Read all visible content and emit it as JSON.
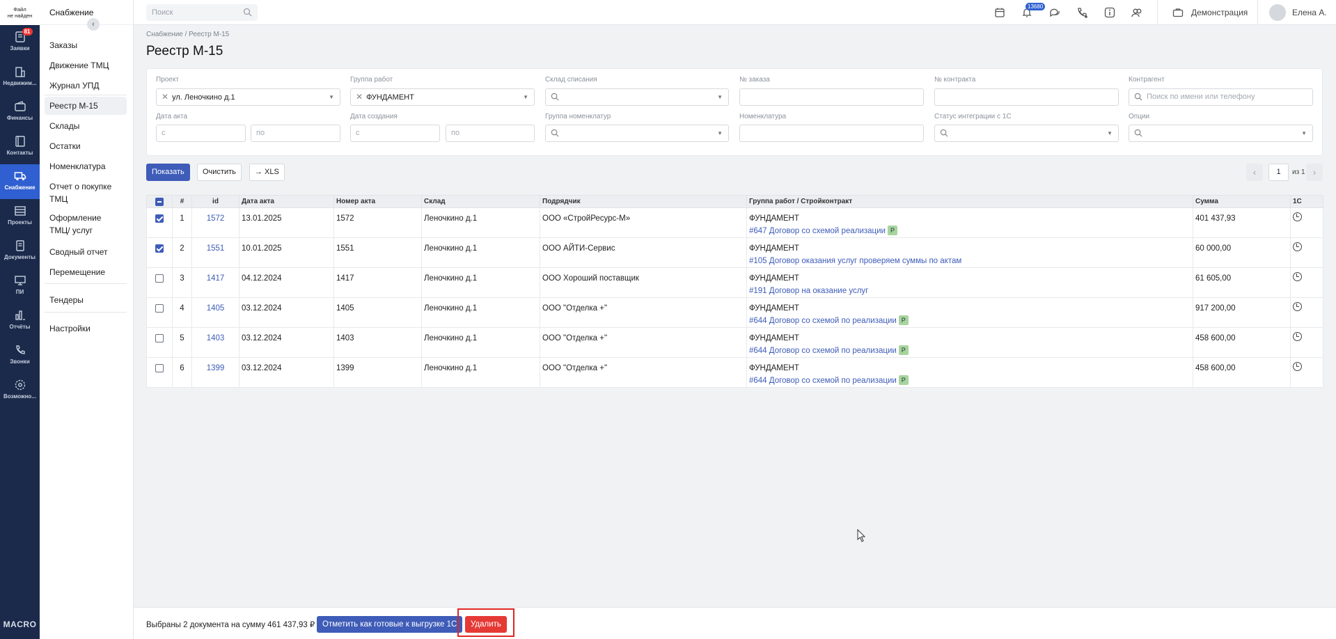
{
  "rail": {
    "file_notice": "Файл\nне найден",
    "items": [
      {
        "label": "Заявки",
        "icon": "requests-icon",
        "badge": "81"
      },
      {
        "label": "Недвижим...",
        "icon": "building-icon"
      },
      {
        "label": "Финансы",
        "icon": "wallet-icon"
      },
      {
        "label": "Контакты",
        "icon": "contacts-icon"
      },
      {
        "label": "Снабжение",
        "icon": "truck-icon",
        "active": true
      },
      {
        "label": "Проекты",
        "icon": "projects-icon"
      },
      {
        "label": "Документы",
        "icon": "documents-icon"
      },
      {
        "label": "ПИ",
        "icon": "monitor-icon"
      },
      {
        "label": "Отчёты",
        "icon": "reports-icon"
      },
      {
        "label": "Звонки",
        "icon": "phone-icon"
      },
      {
        "label": "Возможно...",
        "icon": "settings-gear-icon"
      }
    ],
    "logo": "MACRO"
  },
  "sidebar": {
    "title": "Снабжение",
    "items": [
      {
        "label": "Заказы"
      },
      {
        "label": "Движение ТМЦ"
      },
      {
        "label": "Журнал УПД"
      },
      {
        "label": "Реестр М-15",
        "active": true
      },
      {
        "label": "Склады"
      },
      {
        "label": "Остатки"
      },
      {
        "label": "Номенклатура"
      },
      {
        "label": "Отчет о покупке ТМЦ"
      },
      {
        "label": "Оформление ТМЦ/ услуг"
      },
      {
        "label": "Сводный отчет"
      },
      {
        "label": "Перемещение"
      },
      {
        "label": "Тендеры"
      },
      {
        "label": "Настройки"
      }
    ]
  },
  "topbar": {
    "search_placeholder": "Поиск",
    "notifications_count": "13680",
    "demo_label": "Демонстрация",
    "user_name": "Елена А."
  },
  "breadcrumb": "Снабжение  /  Реестр М-15",
  "page_title": "Реестр М-15",
  "filters": {
    "project": {
      "label": "Проект",
      "value": "ул. Леночкино д.1"
    },
    "work_group": {
      "label": "Группа работ",
      "value": "ФУНДАМЕНТ"
    },
    "writeoff_warehouse": {
      "label": "Склад списания",
      "value": ""
    },
    "order_no": {
      "label": "№ заказа",
      "value": ""
    },
    "contract_no": {
      "label": "№ контракта",
      "value": ""
    },
    "counterparty": {
      "label": "Контрагент",
      "placeholder": "Поиск по имени или телефону"
    },
    "act_date": {
      "label": "Дата акта",
      "from": "с",
      "to": "по"
    },
    "created_date": {
      "label": "Дата создания",
      "from": "с",
      "to": "по"
    },
    "nomenclature_group": {
      "label": "Группа номенклатур",
      "value": ""
    },
    "nomenclature": {
      "label": "Номенклатура",
      "value": ""
    },
    "integration_status": {
      "label": "Статус интеграции с 1С",
      "value": ""
    },
    "options": {
      "label": "Опции",
      "value": ""
    }
  },
  "actions": {
    "show": "Показать",
    "clear": "Очистить",
    "xls": "→ XLS"
  },
  "pager": {
    "page": "1",
    "of": "из 1"
  },
  "table": {
    "headers": [
      "#",
      "id",
      "Дата акта",
      "Номер акта",
      "Склад",
      "Подрядчик",
      "Группа работ / Стройконтракт",
      "Сумма",
      "1С"
    ],
    "rows": [
      {
        "checked": true,
        "n": "1",
        "id": "1572",
        "date": "13.01.2025",
        "act": "1572",
        "warehouse": "Леночкино д.1",
        "contractor": "ООО «СтройРесурс-М»",
        "group": "ФУНДАМЕНТ",
        "contract": "#647 Договор со схемой реализации",
        "tag": "Р",
        "sum": "401 437,93"
      },
      {
        "checked": true,
        "n": "2",
        "id": "1551",
        "date": "10.01.2025",
        "act": "1551",
        "warehouse": "Леночкино д.1",
        "contractor": "ООО АЙТИ-Сервис",
        "group": "ФУНДАМЕНТ",
        "contract": "#105 Договор оказания услуг проверяем суммы по актам",
        "tag": "",
        "sum": "60 000,00"
      },
      {
        "checked": false,
        "n": "3",
        "id": "1417",
        "date": "04.12.2024",
        "act": "1417",
        "warehouse": "Леночкино д.1",
        "contractor": "ООО Хороший поставщик",
        "group": "ФУНДАМЕНТ",
        "contract": "#191 Договор на оказание услуг",
        "tag": "",
        "sum": "61 605,00"
      },
      {
        "checked": false,
        "n": "4",
        "id": "1405",
        "date": "03.12.2024",
        "act": "1405",
        "warehouse": "Леночкино д.1",
        "contractor": "ООО \"Отделка +\"",
        "group": "ФУНДАМЕНТ",
        "contract": "#644 Договор со схемой по реализации",
        "tag": "Р",
        "sum": "917 200,00"
      },
      {
        "checked": false,
        "n": "5",
        "id": "1403",
        "date": "03.12.2024",
        "act": "1403",
        "warehouse": "Леночкино д.1",
        "contractor": "ООО \"Отделка +\"",
        "group": "ФУНДАМЕНТ",
        "contract": "#644 Договор со схемой по реализации",
        "tag": "Р",
        "sum": "458 600,00"
      },
      {
        "checked": false,
        "n": "6",
        "id": "1399",
        "date": "03.12.2024",
        "act": "1399",
        "warehouse": "Леночкино д.1",
        "contractor": "ООО \"Отделка +\"",
        "group": "ФУНДАМЕНТ",
        "contract": "#644 Договор со схемой по реализации",
        "tag": "Р",
        "sum": "458 600,00"
      }
    ]
  },
  "bottom": {
    "selected_text": "Выбраны 2 документа на сумму 461 437,93 ₽",
    "mark_ready": "Отметить как готовые к выгрузке 1С",
    "delete": "Удалить"
  },
  "colors": {
    "rail_bg": "#1b2a4a",
    "accent": "#3e5cb8",
    "danger": "#e53935",
    "tag_green": "#a7d59d"
  }
}
